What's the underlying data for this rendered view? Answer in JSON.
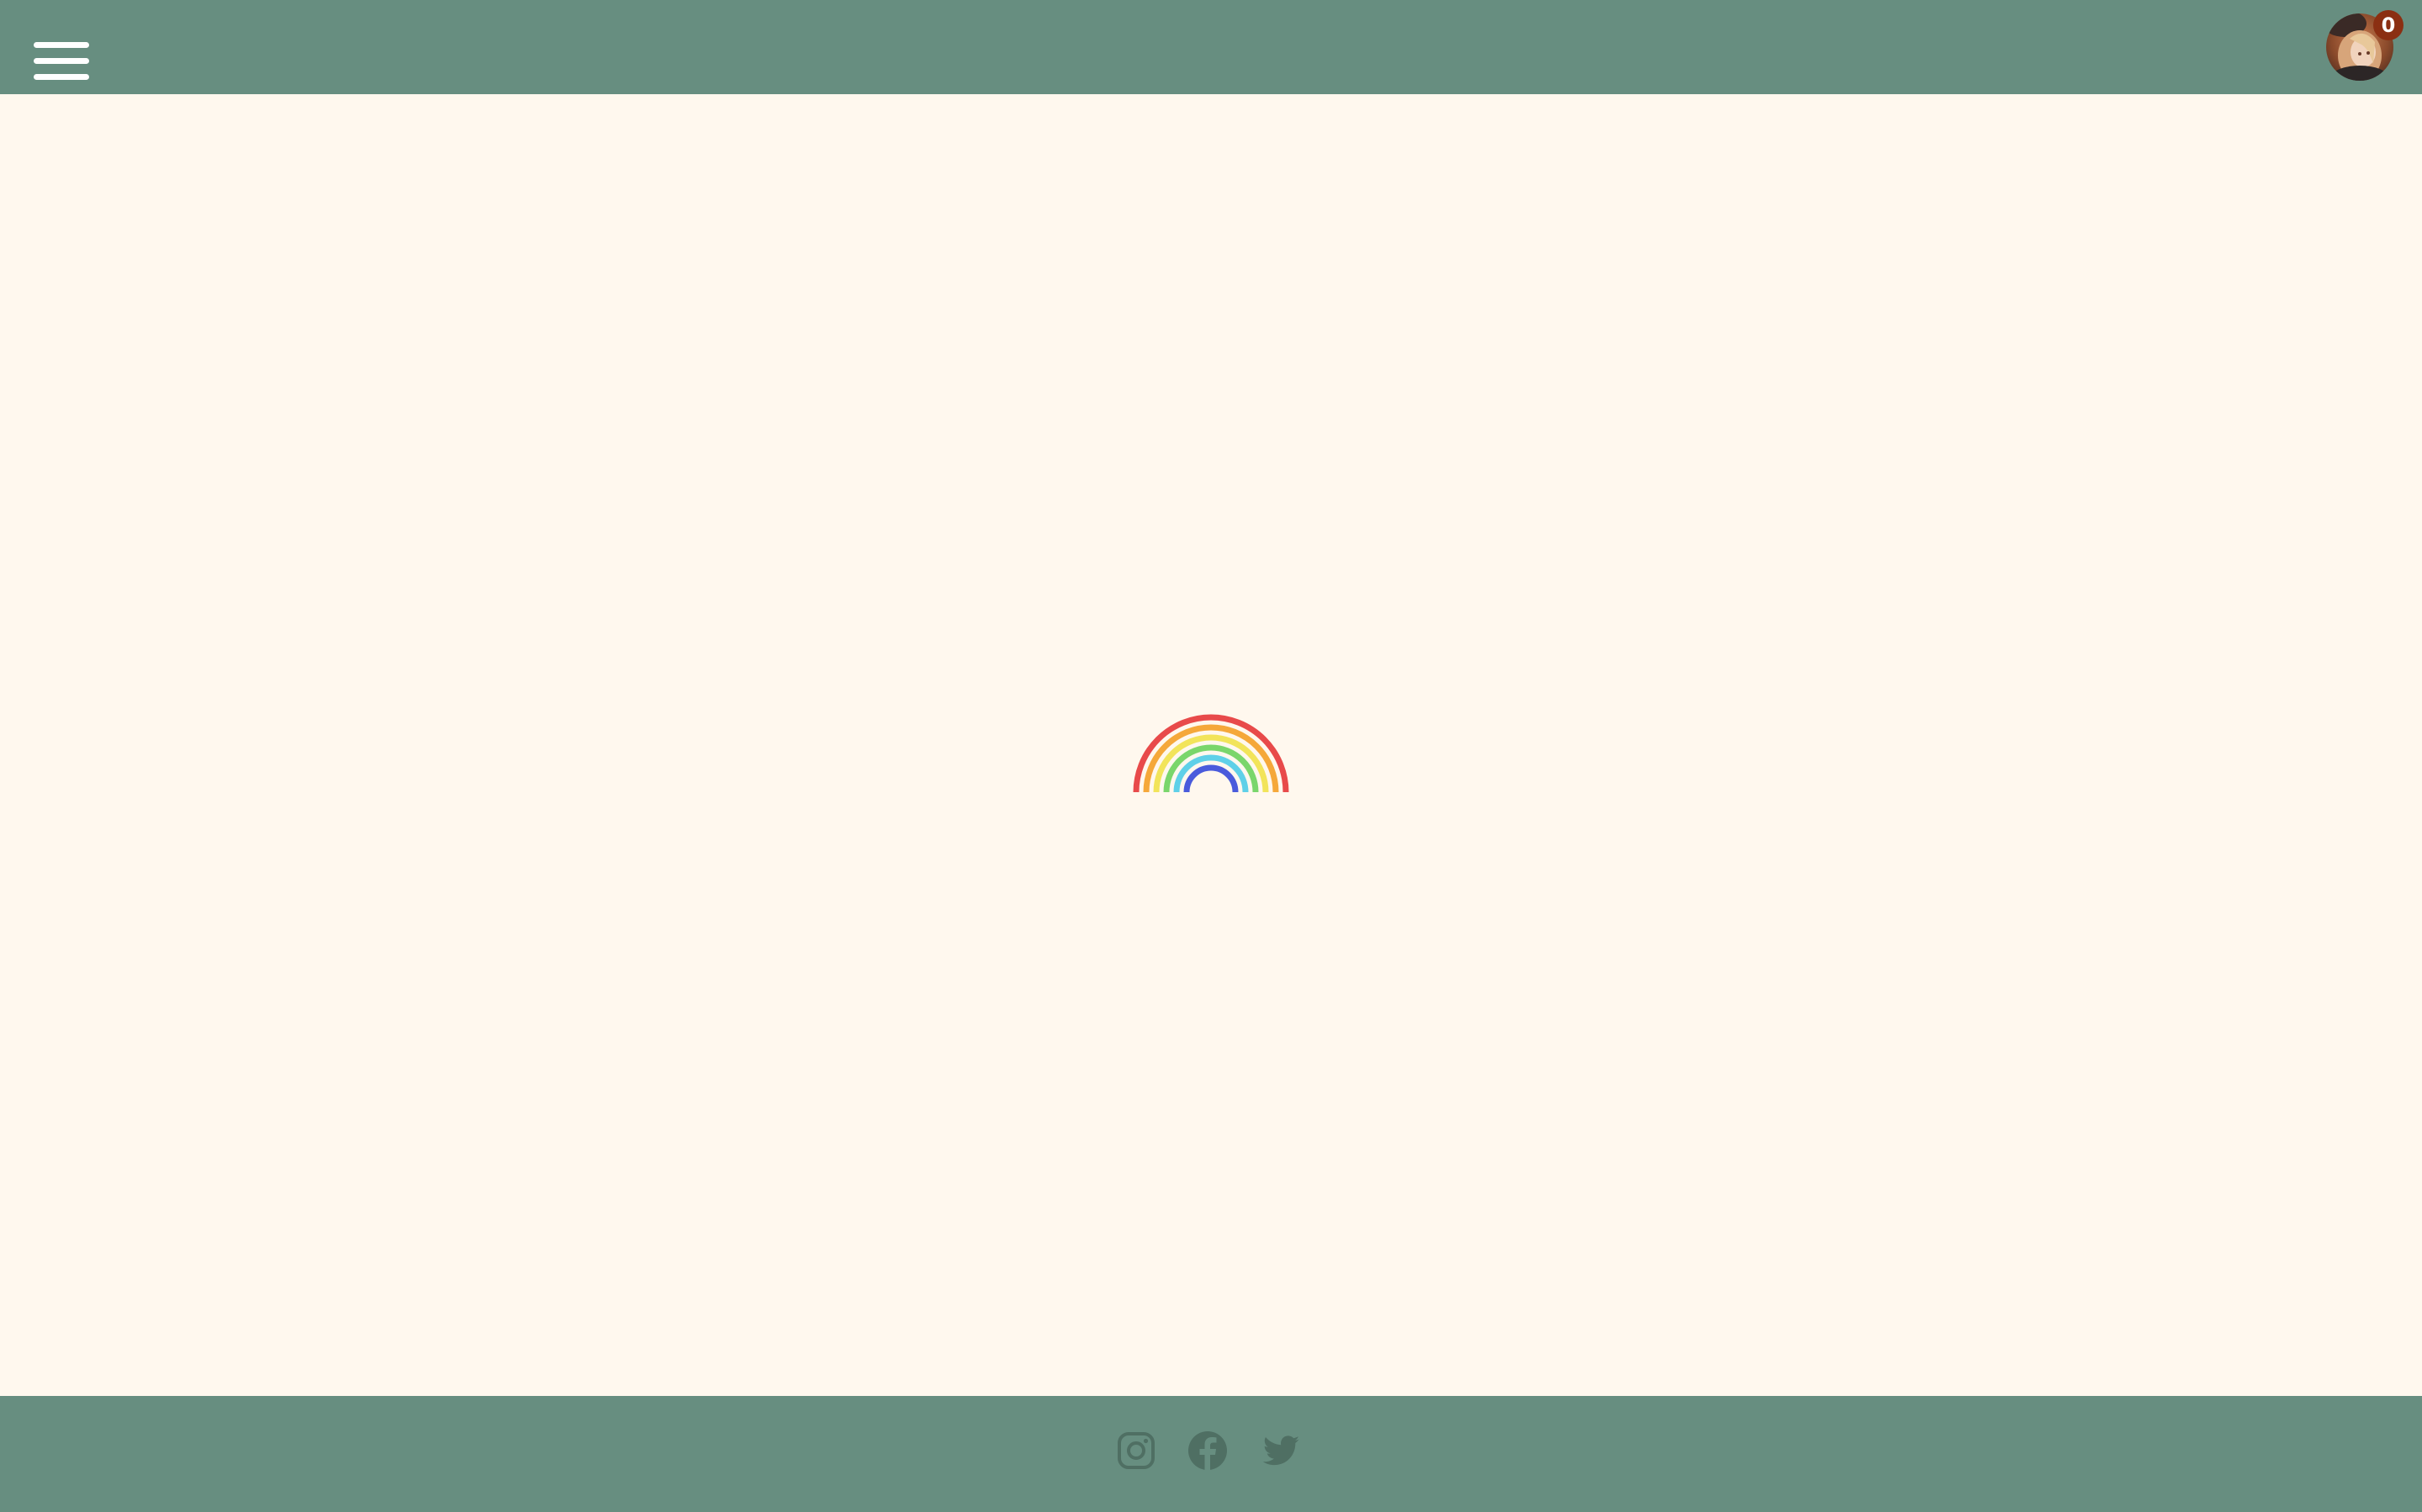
{
  "header": {
    "menu_icon": "hamburger-menu-icon",
    "background_color": "#678e80",
    "profile": {
      "avatar_icon": "user-avatar-photo",
      "notification_count": "0",
      "badge_color": "#8b2f12"
    }
  },
  "main": {
    "background_color": "#fff8ee",
    "loading_indicator": {
      "icon": "rainbow-spinner-icon",
      "colors": [
        "#e84a4a",
        "#f5a83a",
        "#f2e45a",
        "#7ad66b",
        "#5fd0e8",
        "#4a5bdc"
      ]
    }
  },
  "footer": {
    "background_color": "#678e80",
    "social_links": [
      {
        "icon": "instagram-icon"
      },
      {
        "icon": "facebook-icon"
      },
      {
        "icon": "twitter-icon"
      }
    ],
    "icon_color": "#4f6f63"
  }
}
